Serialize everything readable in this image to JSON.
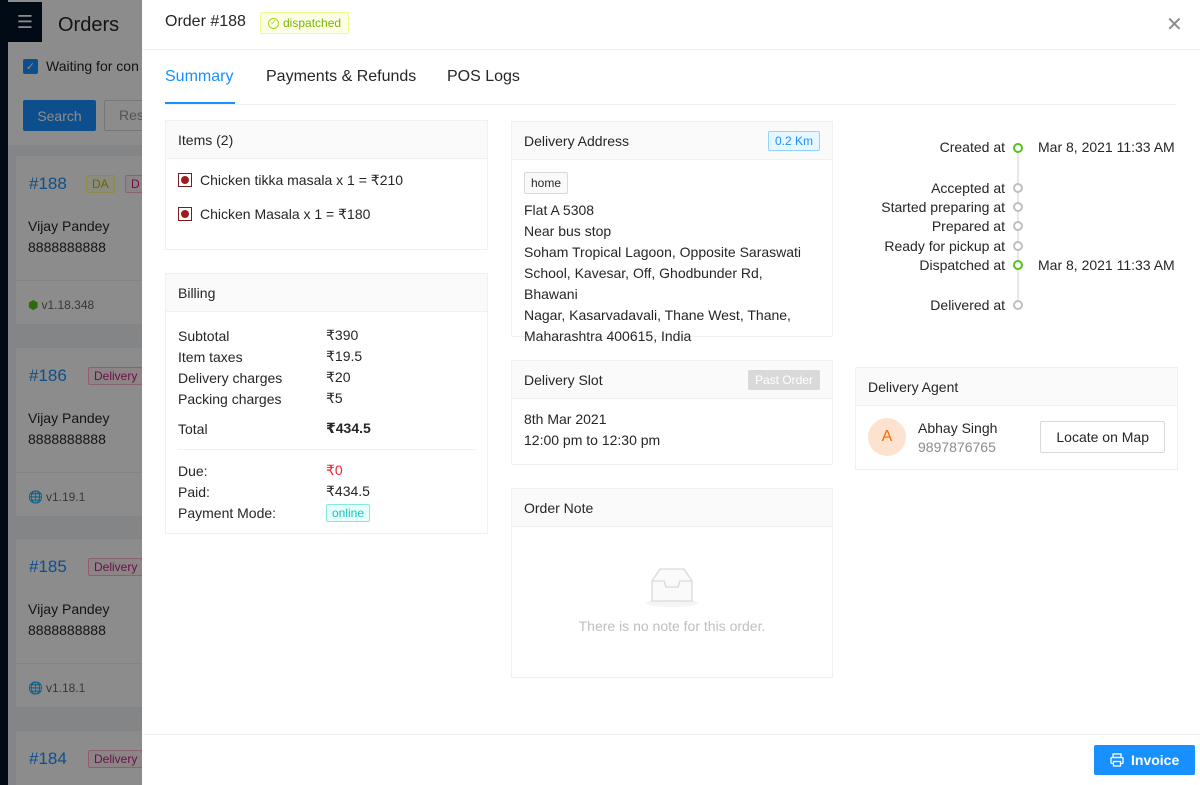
{
  "background": {
    "title": "Orders",
    "checkbox_label": "Waiting for con",
    "search_label": "Search",
    "reset_label": "Res",
    "cards": [
      {
        "number": "#188",
        "tags": [
          "DA",
          "D"
        ],
        "name": "Vijay Pandey",
        "phone": "8888888888",
        "version": "v1.18.348",
        "platform": "android-icon"
      },
      {
        "number": "#186",
        "tags": [
          "Delivery"
        ],
        "name": "Vijay Pandey",
        "phone": "8888888888",
        "version": "v1.19.1",
        "platform": "globe-icon"
      },
      {
        "number": "#185",
        "tags": [
          "Delivery"
        ],
        "name": "Vijay Pandey",
        "phone": "8888888888",
        "version": "v1.18.1",
        "platform": "globe-icon"
      },
      {
        "number": "#184",
        "tags": [
          "Delivery"
        ]
      }
    ]
  },
  "drawer": {
    "title": "Order #188",
    "status": "dispatched",
    "status_color": "#7cb305",
    "tabs": [
      {
        "label": "Summary",
        "active": true
      },
      {
        "label": "Payments & Refunds",
        "active": false
      },
      {
        "label": "POS Logs",
        "active": false
      }
    ]
  },
  "items": {
    "title": "Items (2)",
    "list": [
      {
        "text": "Chicken tikka masala x 1 = ₹210"
      },
      {
        "text": "Chicken Masala x 1 = ₹180"
      }
    ]
  },
  "billing": {
    "title": "Billing",
    "rows": [
      {
        "label": "Subtotal",
        "value": "₹390"
      },
      {
        "label": "Item taxes",
        "value": "₹19.5"
      },
      {
        "label": "Delivery charges",
        "value": "₹20"
      },
      {
        "label": "Packing charges",
        "value": "₹5"
      }
    ],
    "total_label": "Total",
    "total_value": "₹434.5",
    "due_label": "Due:",
    "due_value": "₹0",
    "due_color": "#f5222d",
    "paid_label": "Paid:",
    "paid_value": "₹434.5",
    "mode_label": "Payment Mode:",
    "mode_value": "online"
  },
  "address": {
    "title": "Delivery Address",
    "distance": "0.2 Km",
    "tag": "home",
    "lines": [
      "Flat A 5308",
      "Near bus stop",
      "Soham Tropical Lagoon, Opposite Saraswati",
      "School, Kavesar, Off, Ghodbunder Rd, Bhawani",
      "Nagar, Kasarvadavali, Thane West, Thane,",
      "Maharashtra 400615, India"
    ]
  },
  "slot": {
    "title": "Delivery Slot",
    "tag": "Past Order",
    "date": "8th Mar 2021",
    "time": "12:00 pm to 12:30 pm"
  },
  "note": {
    "title": "Order Note",
    "empty_text": "There is no note for this order."
  },
  "timeline": [
    {
      "label": "Created at",
      "time": "Mar 8, 2021 11:33 AM",
      "done": true
    },
    {
      "label": "Accepted at",
      "time": "",
      "done": false
    },
    {
      "label": "Started preparing at",
      "time": "",
      "done": false
    },
    {
      "label": "Prepared at",
      "time": "",
      "done": false
    },
    {
      "label": "Ready for pickup at",
      "time": "",
      "done": false
    },
    {
      "label": "Dispatched at",
      "time": "Mar 8, 2021 11:33 AM",
      "done": true
    },
    {
      "label": "Delivered at",
      "time": "",
      "done": false
    }
  ],
  "agent": {
    "title": "Delivery Agent",
    "initial": "A",
    "name": "Abhay Singh",
    "phone": "9897876765",
    "locate_label": "Locate on Map"
  },
  "footer": {
    "invoice_label": "Invoice"
  }
}
